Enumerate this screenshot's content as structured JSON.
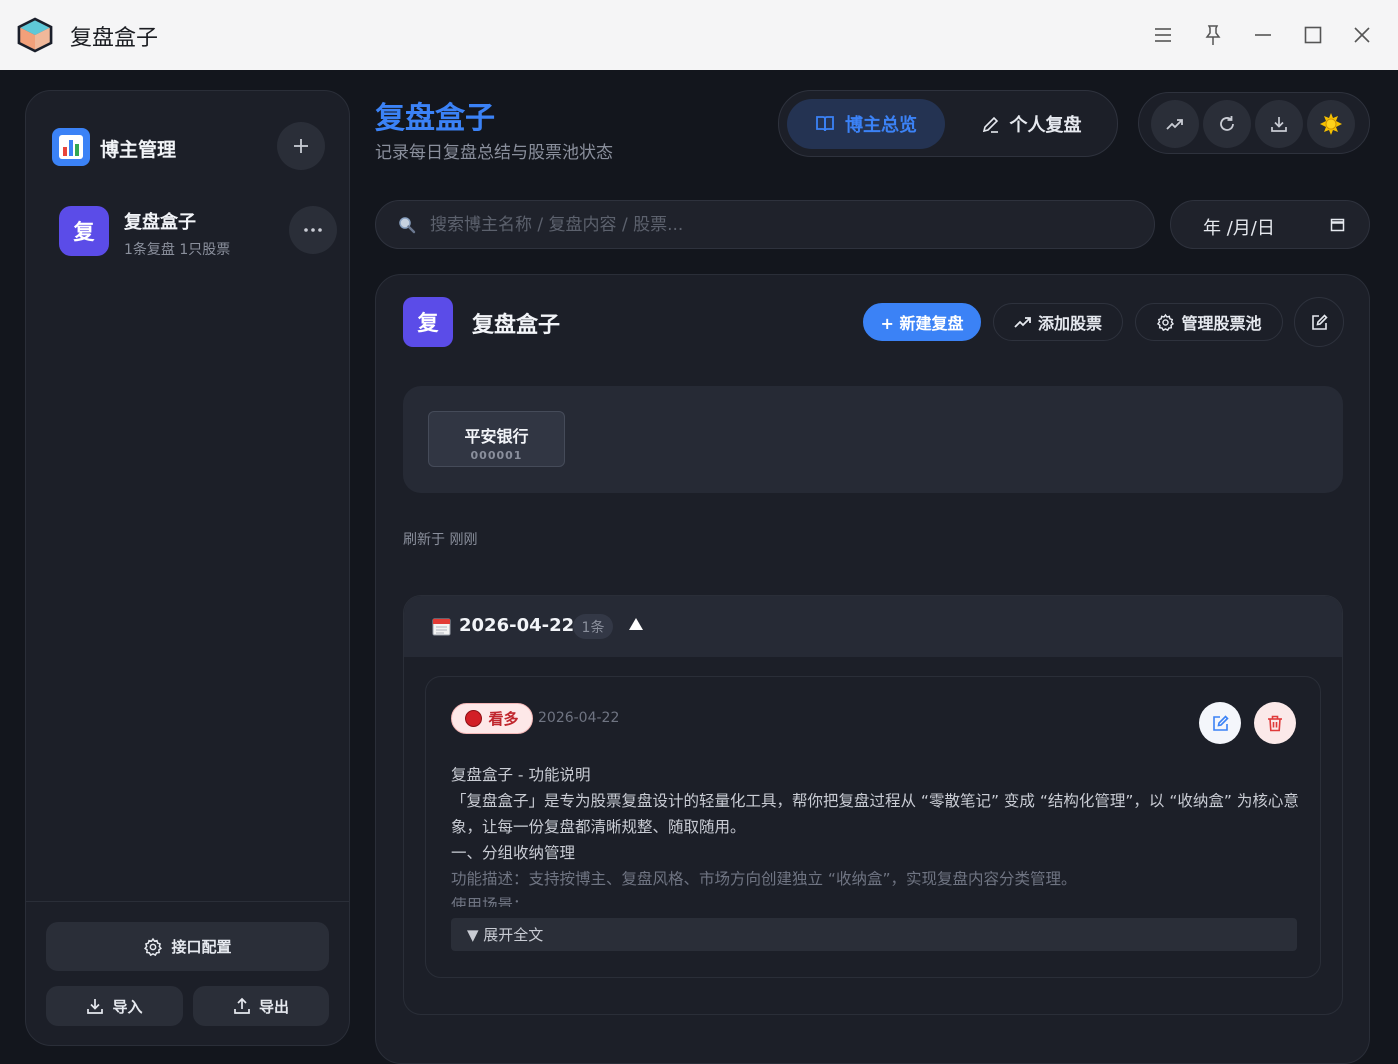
{
  "window": {
    "title": "复盘盒子",
    "controls": [
      "menu-icon",
      "pin-icon",
      "minimize-icon",
      "maximize-icon",
      "close-icon"
    ]
  },
  "sidebar": {
    "title": "博主管理",
    "bloggers": [
      {
        "avatar_char": "复",
        "name": "复盘盒子",
        "meta": "1条复盘 1只股票"
      }
    ],
    "config_label": "接口配置",
    "import_label": "导入",
    "export_label": "导出"
  },
  "header": {
    "title": "复盘盒子",
    "subtitle": "记录每日复盘总结与股票池状态",
    "tabs": [
      {
        "label": "博主总览",
        "active": true
      },
      {
        "label": "个人复盘",
        "active": false
      }
    ],
    "tools": [
      "trend-icon",
      "refresh-icon",
      "download-icon",
      "sun-icon"
    ]
  },
  "search": {
    "placeholder": "搜索博主名称 / 复盘内容 / 股票...",
    "date_placeholder": "年 /月/日"
  },
  "panel": {
    "avatar_char": "复",
    "title": "复盘盒子",
    "new_review_label": "+ 新建复盘",
    "add_stock_label": "添加股票",
    "manage_pool_label": "管理股票池",
    "stocks": [
      {
        "name": "平安银行",
        "code": "000001"
      }
    ],
    "refresh_text": "刷新于 刚刚",
    "groups": [
      {
        "date": "2026-04-22",
        "count": "1条",
        "entries": [
          {
            "tag": "看多",
            "date": "2026-04-22",
            "lines": [
              "复盘盒子 - 功能说明",
              "「复盘盒子」是专为股票复盘设计的轻量化工具，帮你把复盘过程从 “零散笔记” 变成 “结构化管理”，以 “收纳盒” 为核心意象，让每一份复盘都清晰规整、随取随用。",
              "一、分组收纳管理",
              "功能描述：支持按博主、复盘风格、市场方向创建独立 “收纳盒”，实现复盘内容分类管理。",
              "使用场景："
            ],
            "expand_label": "▼ 展开全文"
          }
        ]
      }
    ]
  },
  "colors": {
    "accent": "#3b82f6",
    "avatar": "#5b4ce8",
    "bullish_tag": "#d21f26",
    "background": "#13161d",
    "panel": "#1c1f28"
  }
}
